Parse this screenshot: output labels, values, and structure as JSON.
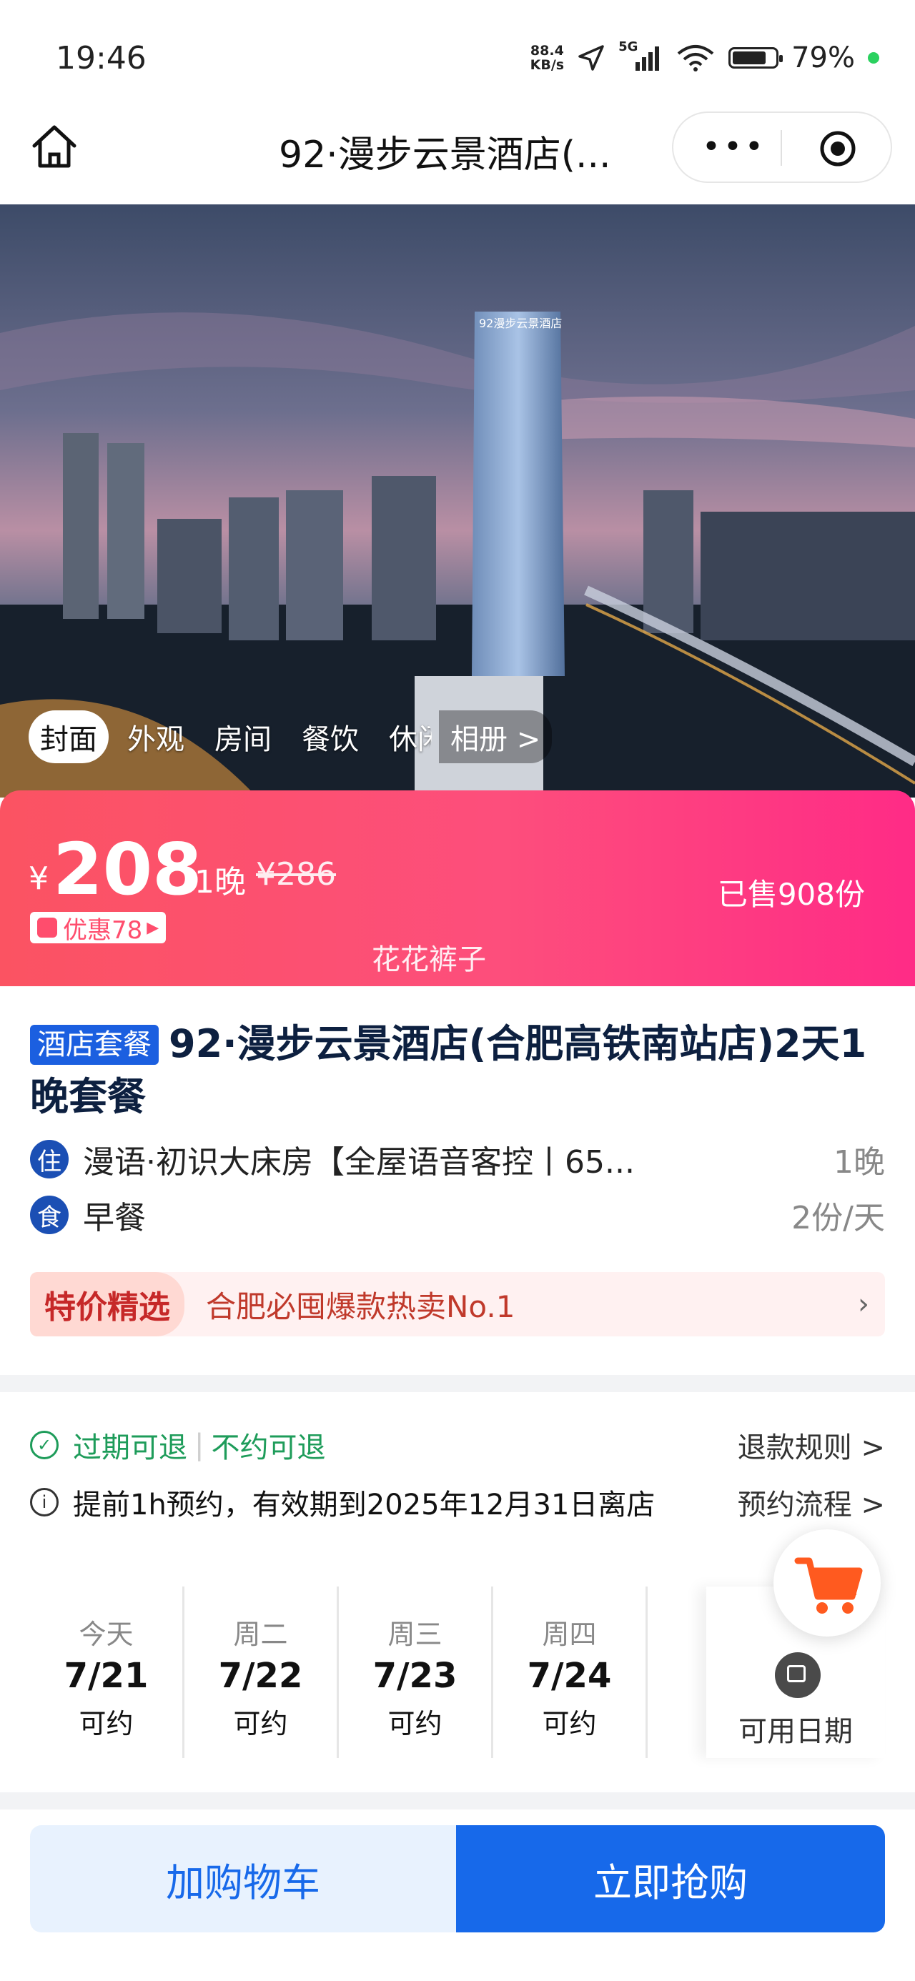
{
  "status_bar": {
    "time": "19:46",
    "net_speed_value": "88.4",
    "net_speed_unit": "KB/s",
    "network": "5G",
    "battery": "79%",
    "battery_level": 0.79
  },
  "nav": {
    "title": "92·漫步云景酒店(..."
  },
  "hero": {
    "album_tabs": [
      "封面",
      "外观",
      "房间",
      "餐饮",
      "休闲"
    ],
    "album_link": "相册 >"
  },
  "price": {
    "currency": "¥",
    "amount": "208",
    "unit": "1晚",
    "original": "¥286",
    "coupon": "优惠78",
    "sold": "已售908份",
    "watermark": "花花裤子"
  },
  "product": {
    "tag": "酒店套餐",
    "title": "92·漫步云景酒店(合肥高铁南站店)2天1晚套餐",
    "rows": [
      {
        "badge": "住",
        "text": "漫语·初识大床房【全屋语音客控丨65...",
        "right": "1晚"
      },
      {
        "badge": "食",
        "text": "早餐",
        "right": "2份/天"
      }
    ],
    "promo_label": "特价精选",
    "promo_text": "合肥必囤爆款热卖No.1"
  },
  "policy": {
    "refund_a": "过期可退",
    "refund_b": "不约可退",
    "refund_link": "退款规则 >",
    "booking_text": "提前1h预约，有效期到2025年12月31日离店",
    "booking_link": "预约流程 >"
  },
  "dates": [
    {
      "week": "今天",
      "date": "7/21",
      "status": "可约"
    },
    {
      "week": "周二",
      "date": "7/22",
      "status": "可约"
    },
    {
      "week": "周三",
      "date": "7/23",
      "status": "可约"
    },
    {
      "week": "周四",
      "date": "7/24",
      "status": "可约"
    }
  ],
  "dates_more_label": "可用日期",
  "bottom": {
    "cart_label": "加购物车",
    "buy_label": "立即抢购"
  },
  "colors": {
    "brand_blue": "#1769ea",
    "price_gradient_start": "#fb5362",
    "price_gradient_end": "#ff2b86",
    "refund_green": "#1e9c5a"
  }
}
